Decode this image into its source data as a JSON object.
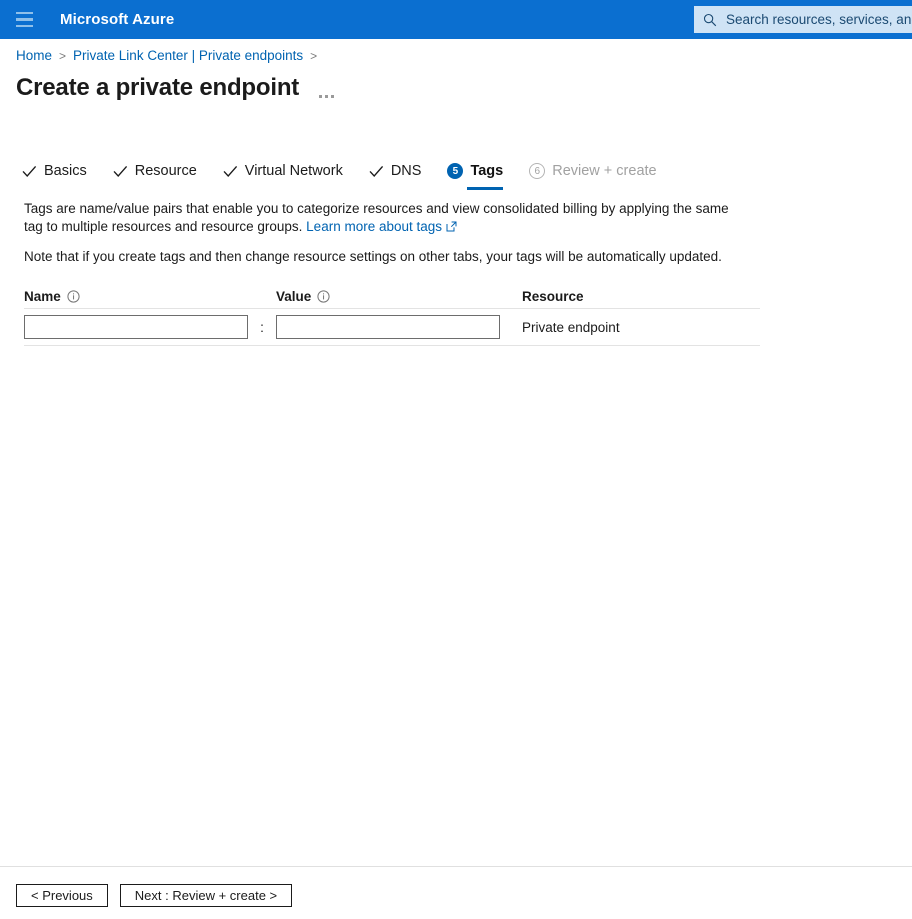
{
  "topbar": {
    "menu_icon": "hamburger-icon",
    "brand": "Microsoft Azure",
    "search": {
      "icon": "search-icon",
      "placeholder": "Search resources, services, and d",
      "value": ""
    },
    "background_color": "#0b6fd0"
  },
  "breadcrumb": {
    "items": [
      {
        "label": "Home",
        "link": true
      },
      {
        "label": "Private Link Center | Private endpoints",
        "link": true
      }
    ],
    "separator": ">"
  },
  "header": {
    "title": "Create a private endpoint",
    "more_menu_icon": "ellipsis-icon"
  },
  "wizard": {
    "tabs": [
      {
        "label": "Basics",
        "state": "completed",
        "icon": "check-icon"
      },
      {
        "label": "Resource",
        "state": "completed",
        "icon": "check-icon"
      },
      {
        "label": "Virtual Network",
        "state": "completed",
        "icon": "check-icon"
      },
      {
        "label": "DNS",
        "state": "completed",
        "icon": "check-icon"
      },
      {
        "label": "Tags",
        "state": "active",
        "badge": "5"
      },
      {
        "label": "Review + create",
        "state": "disabled",
        "badge": "6"
      }
    ],
    "accent_color": "#0063b1"
  },
  "content": {
    "description_part1": "Tags are name/value pairs that enable you to categorize resources and view consolidated billing by applying the same tag to multiple resources and resource groups.",
    "learn_more_label": "Learn more about tags",
    "learn_more_icon": "external-link-icon",
    "note": "Note that if you create tags and then change resource settings on other tabs, your tags will be automatically updated."
  },
  "tags_table": {
    "columns": [
      {
        "label": "Name",
        "info_icon": "info-icon"
      },
      {
        "label": "Value",
        "info_icon": "info-icon"
      },
      {
        "label": "Resource",
        "info_icon": null
      }
    ],
    "separator": ":",
    "rows": [
      {
        "name_value": "",
        "name_placeholder": "",
        "value_value": "",
        "value_placeholder": "",
        "resource": "Private endpoint"
      }
    ]
  },
  "footer": {
    "previous_label": "< Previous",
    "next_label": "Next : Review + create >"
  }
}
